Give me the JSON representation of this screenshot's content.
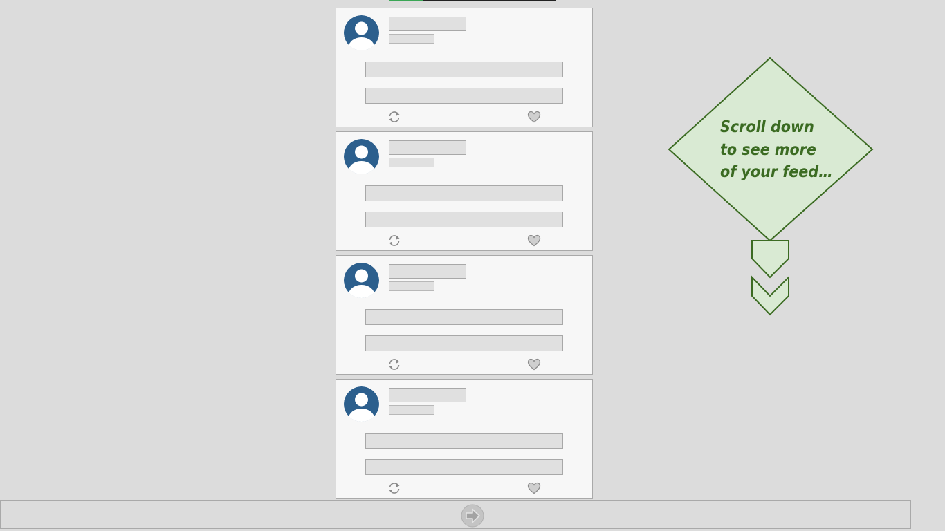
{
  "progress": {
    "fraction": 0.2
  },
  "feed": {
    "posts": [
      {
        "retweet_icon": "retweet-icon",
        "like_icon": "heart-icon"
      },
      {
        "retweet_icon": "retweet-icon",
        "like_icon": "heart-icon"
      },
      {
        "retweet_icon": "retweet-icon",
        "like_icon": "heart-icon"
      },
      {
        "retweet_icon": "retweet-icon",
        "like_icon": "heart-icon"
      }
    ]
  },
  "hint": {
    "lines": [
      "Scroll down",
      "to see more",
      "of your feed…"
    ],
    "text_color": "#3b6b22",
    "fill_color": "#d9ead3",
    "stroke_color": "#3b6b22"
  },
  "bottom_bar": {
    "next_icon": "arrow-right-circle-icon"
  },
  "colors": {
    "background": "#dcdcdc",
    "card": "#f7f7f7",
    "avatar": "#2c5f8d",
    "placeholder": "#e0e0e0",
    "progress_fill": "#3aa655"
  }
}
